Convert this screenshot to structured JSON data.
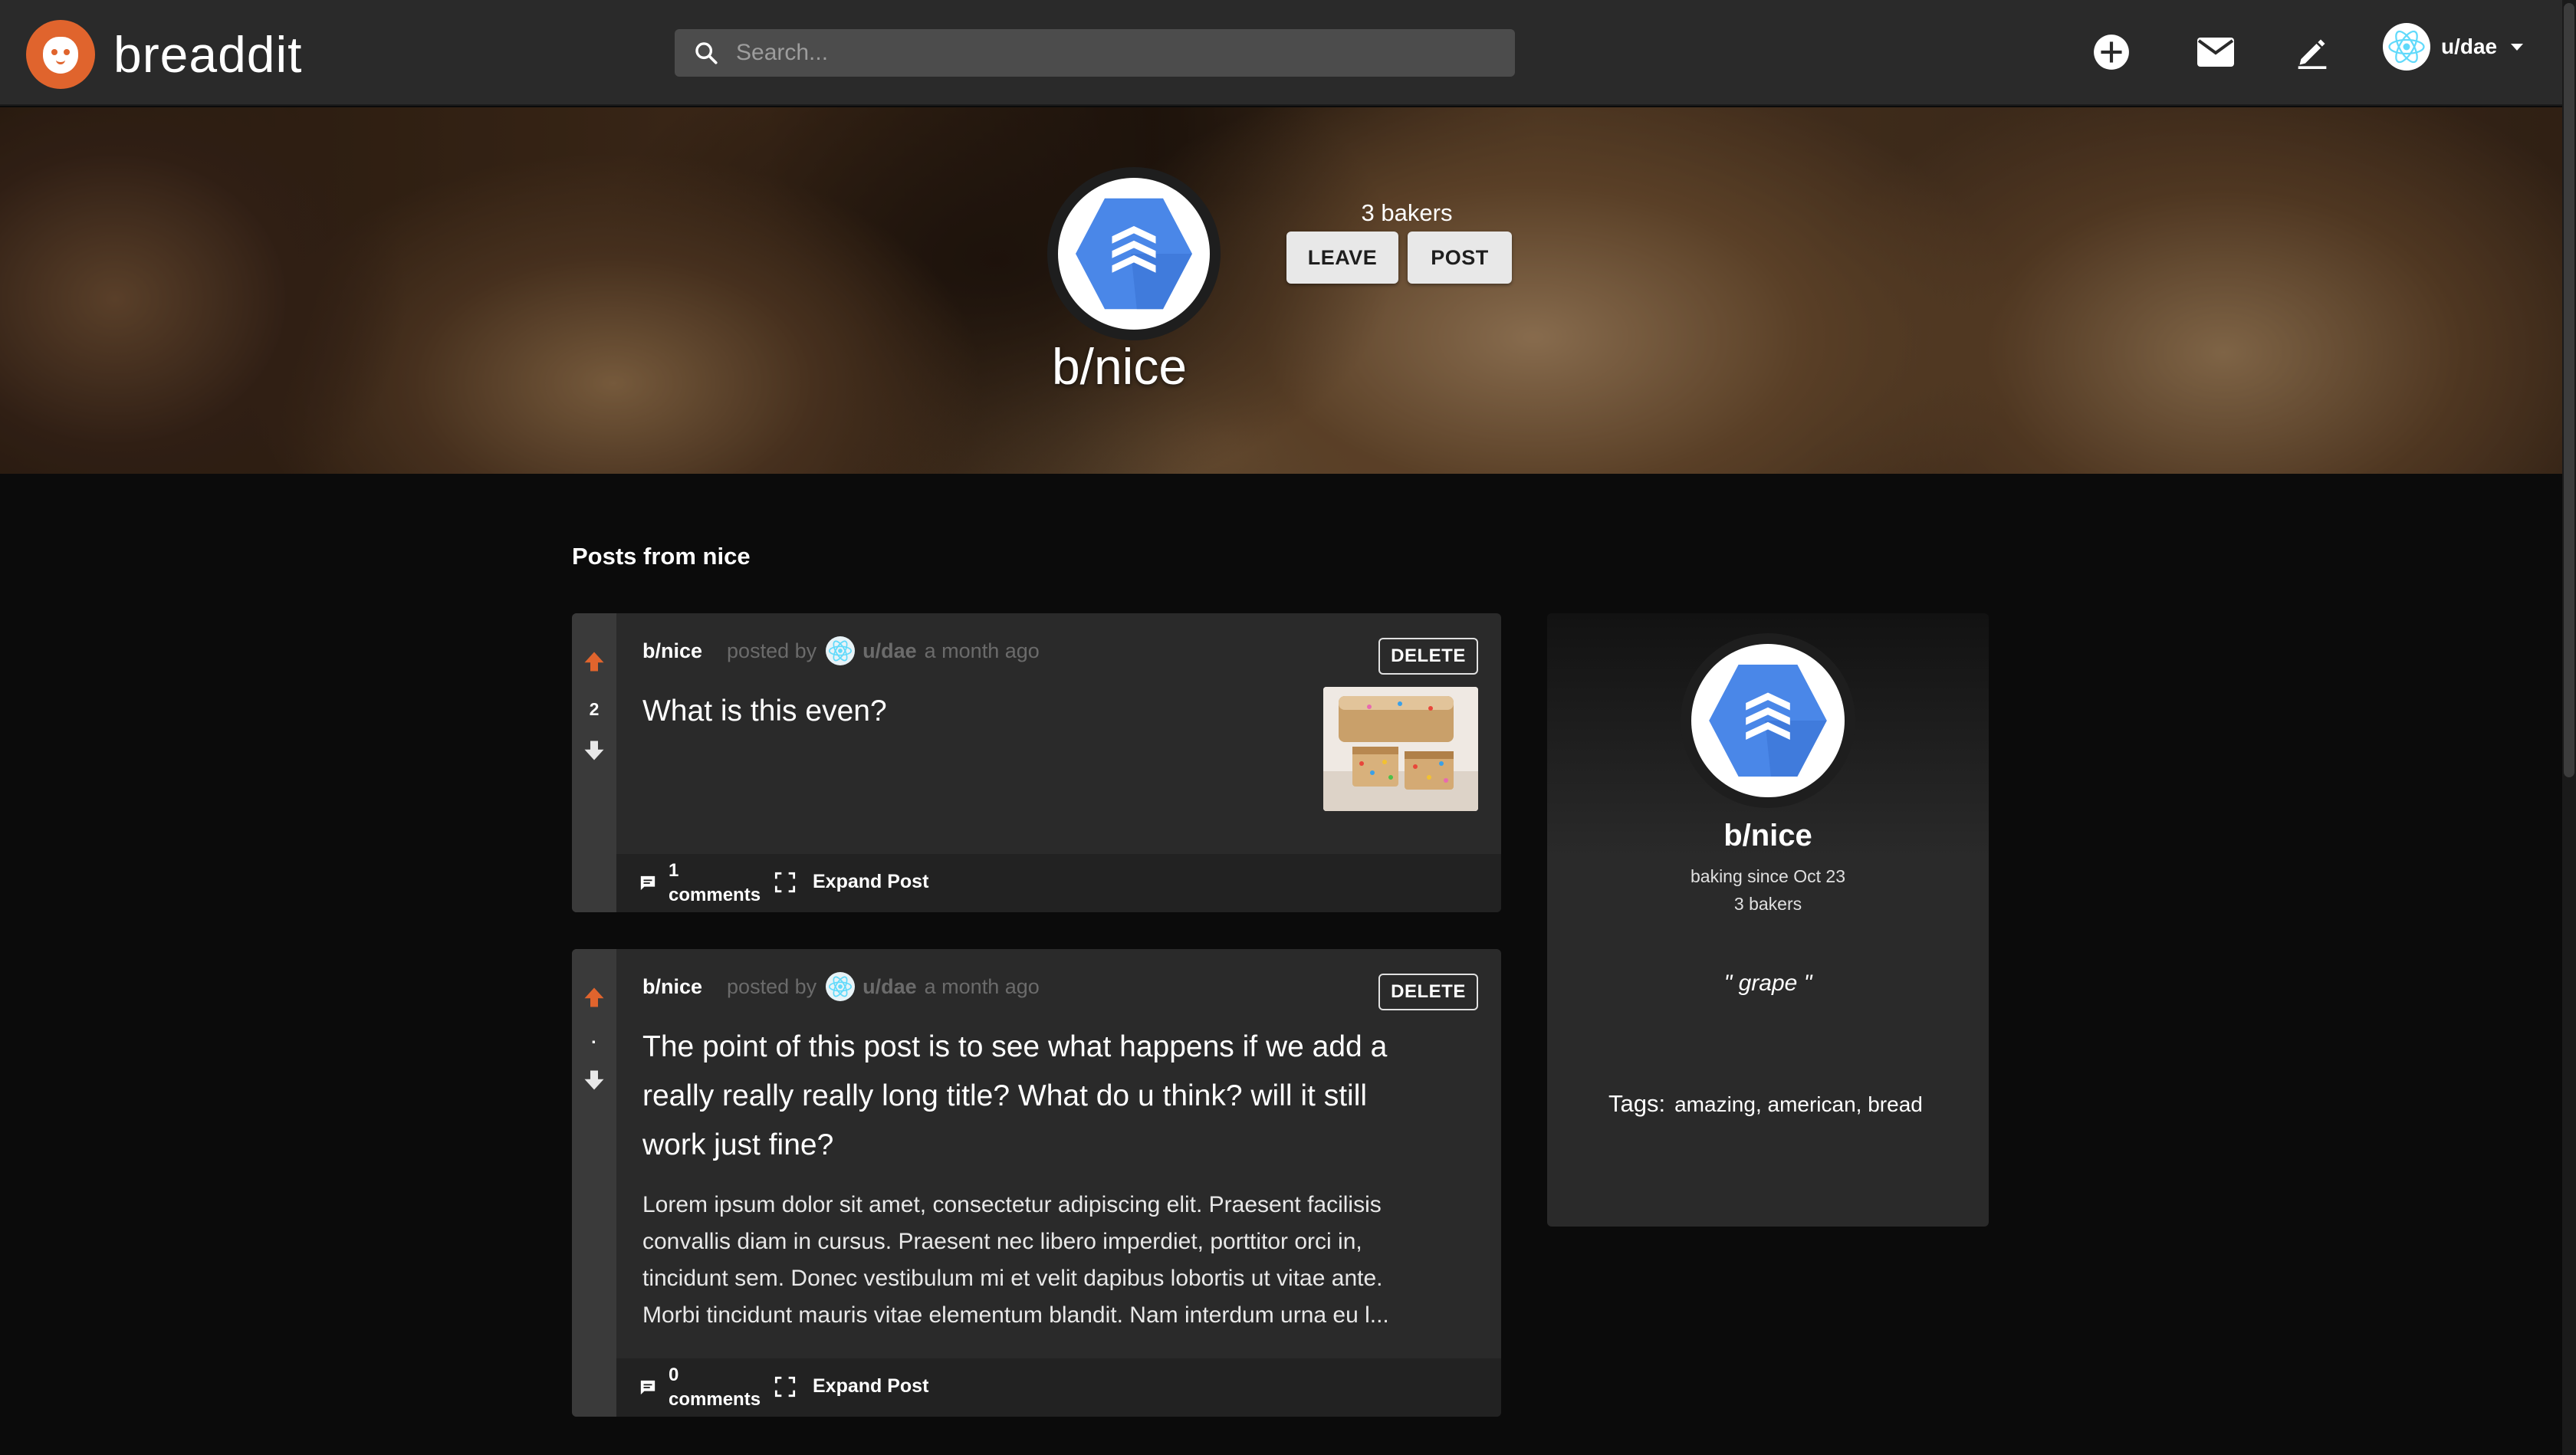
{
  "header": {
    "app_name": "breaddit",
    "search_placeholder": "Search...",
    "user": "u/dae"
  },
  "banner": {
    "subreddit": "b/nice",
    "bakers": "3 bakers",
    "leave_label": "LEAVE",
    "post_label": "POST"
  },
  "main": {
    "section_title": "Posts from nice",
    "posts": [
      {
        "sub": "b/nice",
        "posted_by": "posted by",
        "user": "u/dae",
        "time": "a month ago",
        "delete_label": "DELETE",
        "votes": "2",
        "title": "What is this even?",
        "comments_count": "1",
        "comments_label": "comments",
        "expand_label": "Expand Post"
      },
      {
        "sub": "b/nice",
        "posted_by": "posted by",
        "user": "u/dae",
        "time": "a month ago",
        "delete_label": "DELETE",
        "votes": "·",
        "title_lines": [
          "The point of this post is to see what happens if we add a",
          "really really really long title? What do u think? will it still",
          "work just fine?"
        ],
        "body_lines": [
          "Lorem ipsum dolor sit amet, consectetur adipiscing elit. Praesent facilisis",
          "convallis diam in cursus. Praesent nec libero imperdiet, porttitor orci in,",
          "tincidunt sem. Donec vestibulum mi et velit dapibus lobortis ut vitae ante.",
          "Morbi tincidunt mauris vitae elementum blandit. Nam interdum urna eu l..."
        ],
        "comments_count": "0",
        "comments_label": "comments",
        "expand_label": "Expand Post"
      }
    ]
  },
  "sidebar": {
    "name": "b/nice",
    "since": "baking since Oct 23",
    "bakers": "3 bakers",
    "quote": "\" grape \"",
    "tags_label": "Tags:",
    "tags": "amazing, american, bread"
  },
  "colors": {
    "accent": "#e0642d",
    "upvote": "#e0642d",
    "hex_blue": "#4a87e8",
    "panel": "#2a2a2a",
    "background": "#0b0b0b"
  },
  "icons": [
    "breaddit-logo",
    "search-icon",
    "add-circle-icon",
    "mail-icon",
    "pencil-icon",
    "react-avatar-icon",
    "caret-down-icon",
    "hexagon-stack-icon",
    "upvote-arrow-icon",
    "downvote-arrow-icon",
    "comment-icon",
    "expand-icon"
  ]
}
